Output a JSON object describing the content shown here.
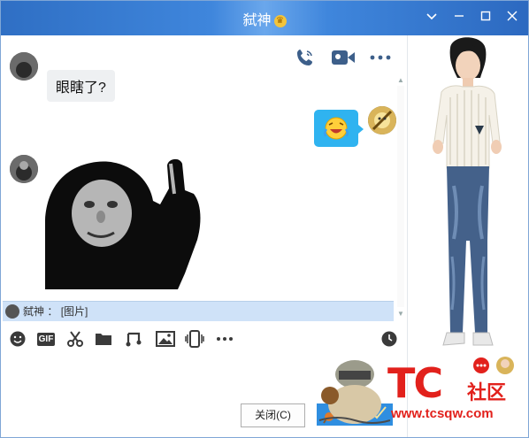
{
  "window": {
    "title": "弑神",
    "title_badge_icon": "crown-icon",
    "controls": [
      "chevron-down-icon",
      "minimize-icon",
      "maximize-icon",
      "close-icon"
    ]
  },
  "chat_toolbar": {
    "icons": [
      "phone-call-icon",
      "video-call-icon",
      "more-icon"
    ]
  },
  "messages": [
    {
      "side": "left",
      "type": "text",
      "text": "眼瞎了?"
    },
    {
      "side": "right",
      "type": "emoji",
      "icon": "laughing-crying-emoji-icon"
    },
    {
      "side": "left",
      "type": "image",
      "icon": "meme-middle-finger-image"
    }
  ],
  "notice": {
    "sender": "弑神",
    "separator": "：",
    "content": "[图片]"
  },
  "input_toolbar": {
    "gif_label": "GIF",
    "icons": [
      "emoji-icon",
      "gif-icon",
      "scissors-icon",
      "folder-icon",
      "music-icon",
      "image-icon",
      "shake-icon",
      "more-icon",
      "history-clock-icon"
    ]
  },
  "buttons": {
    "close_label": "关闭(C)",
    "send_icon": "send-icon"
  },
  "watermark": {
    "logo": "TC",
    "community": "社区",
    "url": "www.tcsqw.com"
  },
  "colors": {
    "titlebar": "#3f86dc",
    "accent": "#2fb3f0",
    "notice_bg": "#cfe2f8",
    "watermark": "#e2211c"
  }
}
